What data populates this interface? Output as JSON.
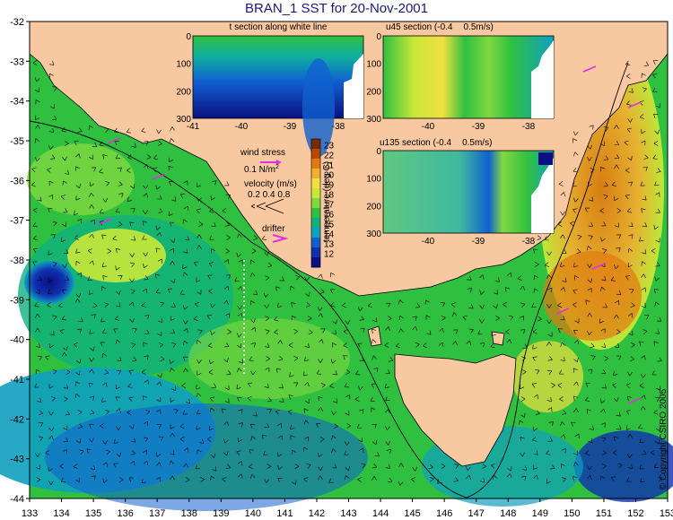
{
  "title": "BRAN_1 SST for 20-Nov-2001",
  "axes": {
    "lon_ticks": [
      "133",
      "134",
      "135",
      "136",
      "137",
      "138",
      "139",
      "140",
      "141",
      "142",
      "143",
      "144",
      "145",
      "146",
      "147",
      "148",
      "149",
      "150",
      "151",
      "152",
      "153"
    ],
    "lat_ticks": [
      "-32",
      "-33",
      "-34",
      "-35",
      "-36",
      "-37",
      "-38",
      "-39",
      "-40",
      "-41",
      "-42",
      "-43",
      "-44"
    ]
  },
  "insets": {
    "t_section": {
      "title": "t section along white line",
      "y_ticks": [
        "0",
        "100",
        "200",
        "300"
      ],
      "x_ticks": [
        "-41",
        "-40",
        "-39",
        "-38"
      ]
    },
    "u45_section": {
      "title": "u45 section (-0.4",
      "range_end": "0.5m/s)",
      "y_ticks": [
        "0",
        "100",
        "200",
        "300"
      ],
      "x_ticks": [
        "-40",
        "-39",
        "-38"
      ]
    },
    "u135_section": {
      "title": "u135 section (-0.4",
      "range_end": "0.5m/s)",
      "y_ticks": [
        "0",
        "100",
        "200",
        "300"
      ],
      "x_ticks": [
        "-40",
        "-39",
        "-38"
      ]
    }
  },
  "legend": {
    "wind_stress_label": "wind stress",
    "wind_stress_value": "0.1 N/m",
    "wind_stress_sup": "2",
    "velocity_label": "velocity (m/s)",
    "velocity_values": "0.2 0.4 0.8",
    "drifter_label": "drifter"
  },
  "colorbar": {
    "label": "temperature (deg C)",
    "ticks": [
      "23",
      "22",
      "21",
      "20",
      "19",
      "18",
      "17",
      "16",
      "15",
      "14",
      "13",
      "12"
    ],
    "colors": [
      "#7a2a00",
      "#b84a00",
      "#e07a10",
      "#f0b030",
      "#f0e040",
      "#c8e838",
      "#80d840",
      "#30c040",
      "#10b080",
      "#10a0c0",
      "#1060d0",
      "#1030b0",
      "#0a1080"
    ]
  },
  "copyright": "© Copyright CSIRO 2005",
  "colors": {
    "land": "#f8c8a0",
    "ocean_warm": "#30c040",
    "ocean_cool": "#1060d0",
    "vector": "#000000",
    "wind": "#e030e0",
    "title": "#1a1a80"
  }
}
